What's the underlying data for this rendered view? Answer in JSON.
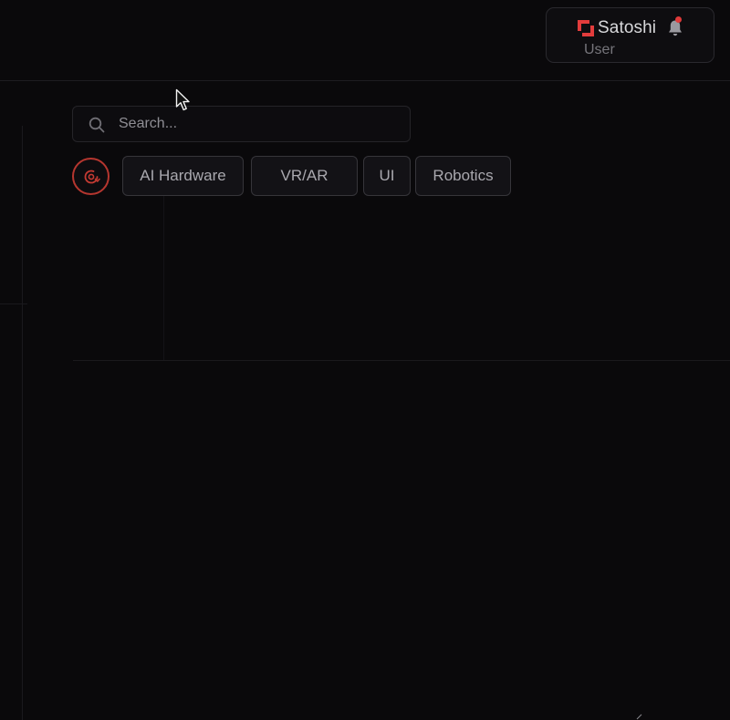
{
  "header": {
    "user": {
      "name": "Satoshi",
      "role": "User",
      "logo_icon": "brand-logo-icon",
      "notification_icon": "bell-icon",
      "accent_color": "#e03a3a"
    }
  },
  "search": {
    "placeholder": "Search...",
    "value": "",
    "icon": "search-icon"
  },
  "filters": {
    "reset_icon": "reset-filter-icon",
    "reset_color": "#b5362f",
    "chips": [
      {
        "label": "AI Hardware"
      },
      {
        "label": "VR/AR"
      },
      {
        "label": "UI"
      },
      {
        "label": "Robotics"
      }
    ]
  }
}
